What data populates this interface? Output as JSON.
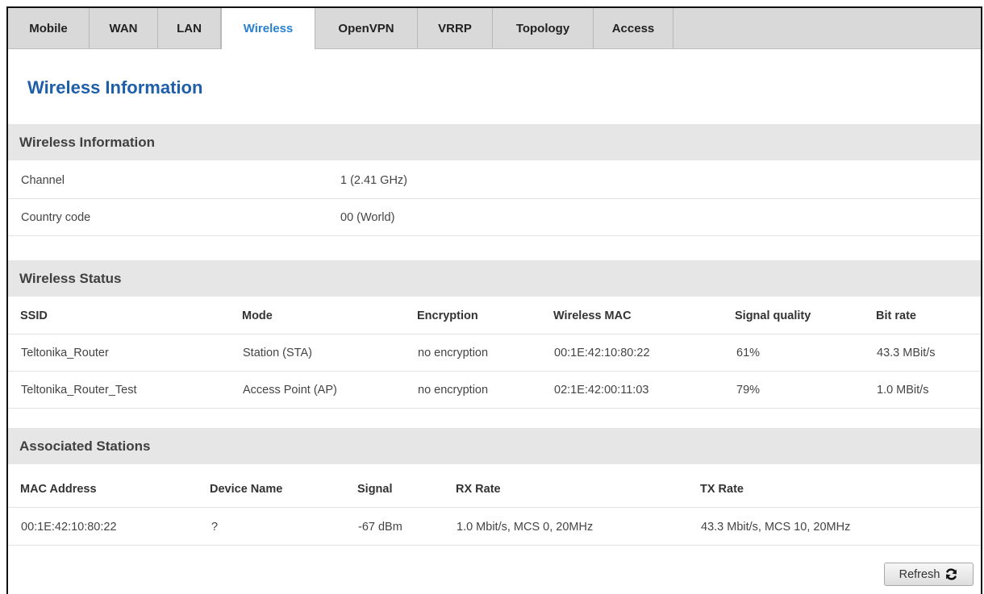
{
  "tabs": [
    {
      "label": "Mobile",
      "active": false
    },
    {
      "label": "WAN",
      "active": false
    },
    {
      "label": "LAN",
      "active": false
    },
    {
      "label": "Wireless",
      "active": true
    },
    {
      "label": "OpenVPN",
      "active": false
    },
    {
      "label": "VRRP",
      "active": false
    },
    {
      "label": "Topology",
      "active": false
    },
    {
      "label": "Access",
      "active": false
    }
  ],
  "page_title": "Wireless Information",
  "wireless_info": {
    "heading": "Wireless Information",
    "rows": [
      {
        "label": "Channel",
        "value": "1 (2.41 GHz)"
      },
      {
        "label": "Country code",
        "value": "00 (World)"
      }
    ]
  },
  "wireless_status": {
    "heading": "Wireless Status",
    "columns": [
      "SSID",
      "Mode",
      "Encryption",
      "Wireless MAC",
      "Signal quality",
      "Bit rate"
    ],
    "rows": [
      [
        "Teltonika_Router",
        "Station (STA)",
        "no encryption",
        "00:1E:42:10:80:22",
        "61%",
        "43.3 MBit/s"
      ],
      [
        "Teltonika_Router_Test",
        "Access Point (AP)",
        "no encryption",
        "02:1E:42:00:11:03",
        "79%",
        "1.0 MBit/s"
      ]
    ]
  },
  "associated_stations": {
    "heading": "Associated Stations",
    "columns": [
      "MAC Address",
      "Device Name",
      "Signal",
      "RX Rate",
      "TX Rate"
    ],
    "rows": [
      [
        "00:1E:42:10:80:22",
        "?",
        "-67 dBm",
        "1.0 Mbit/s, MCS 0, 20MHz",
        "43.3 Mbit/s, MCS 10, 20MHz"
      ]
    ]
  },
  "refresh_button": {
    "label": "Refresh",
    "icon": "refresh-icon"
  },
  "colors": {
    "accent": "#2a7fd0",
    "title": "#1f5ea8",
    "section_bg": "#e6e6e6",
    "tabbar_bg": "#d9d9d9"
  }
}
